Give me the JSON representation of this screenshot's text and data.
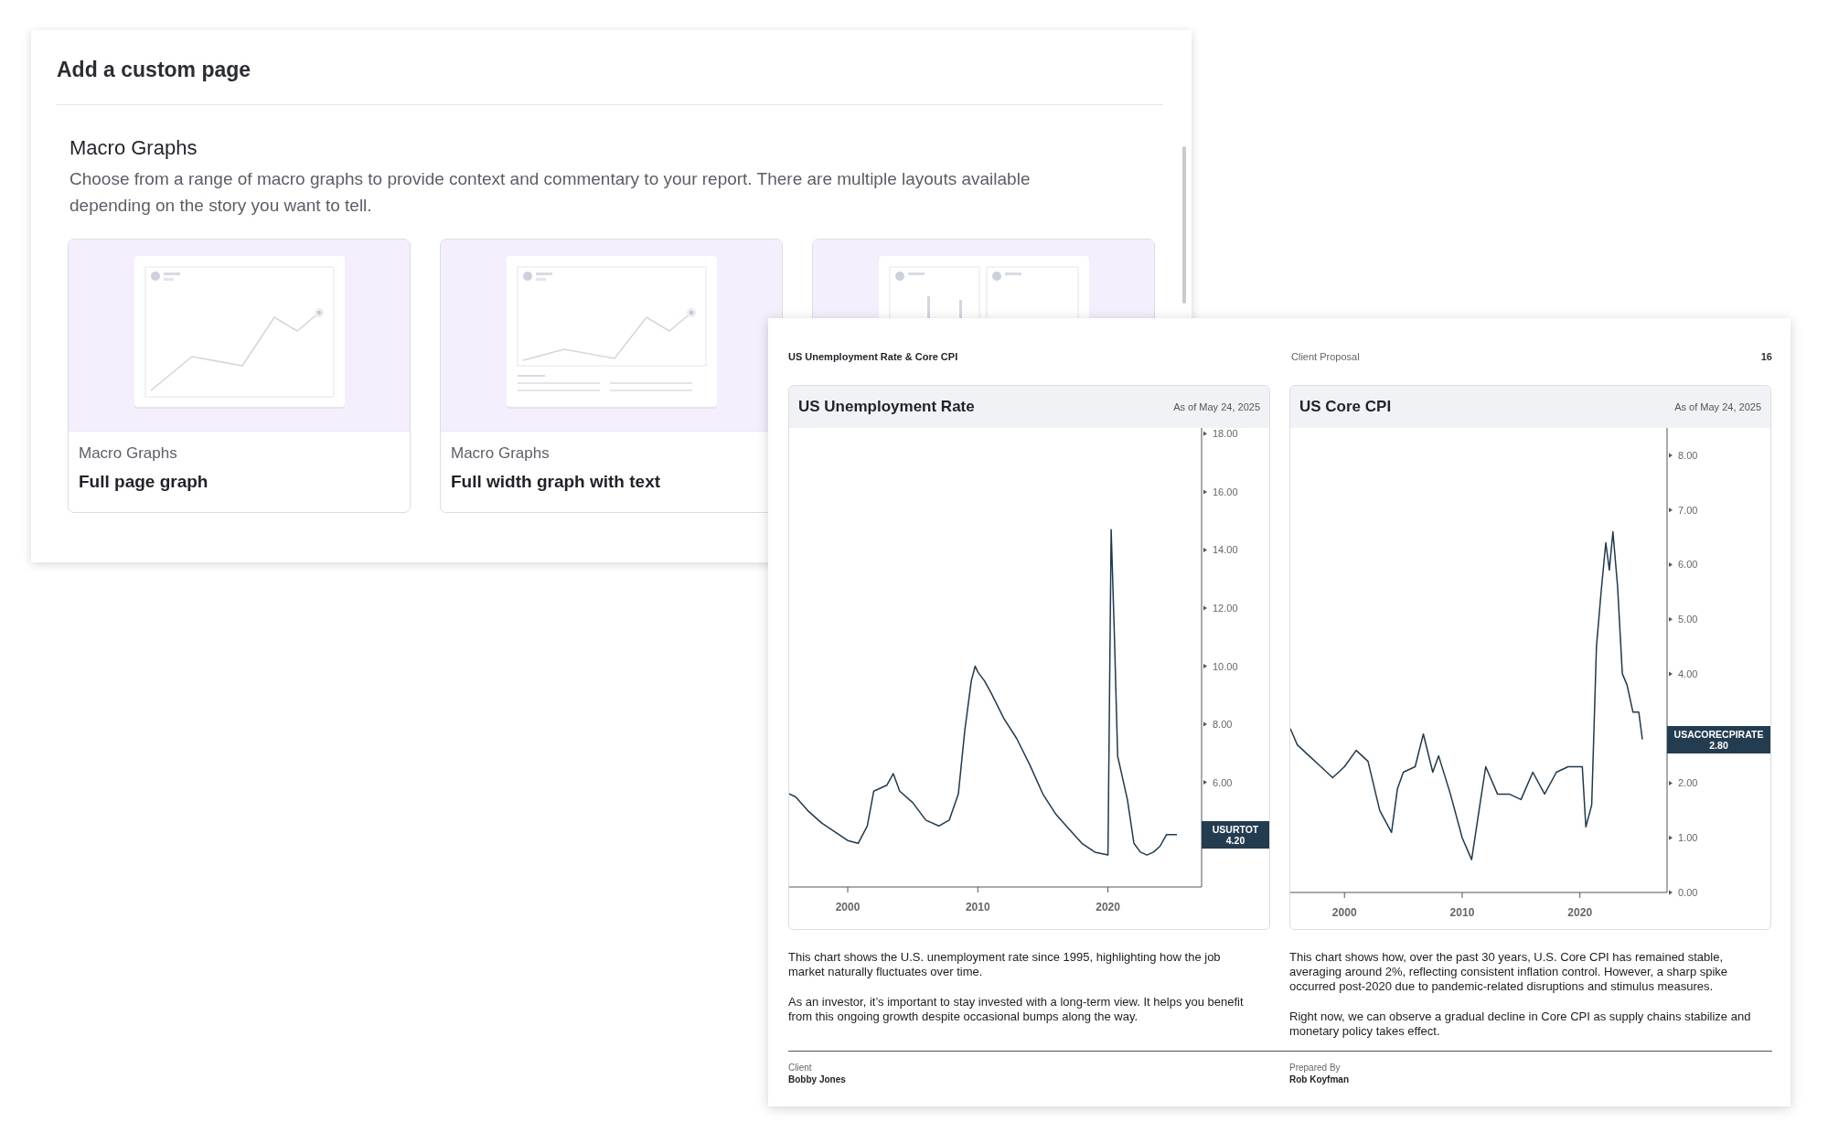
{
  "panel": {
    "title": "Add a custom page",
    "section": {
      "heading": "Macro Graphs",
      "description": "Choose from a range of macro graphs to provide context and commentary to your report. There are multiple layouts available depending on the story you want to tell."
    },
    "cards": [
      {
        "kind": "full_page",
        "category": "Macro Graphs",
        "title": "Full page graph"
      },
      {
        "kind": "full_width_text",
        "category": "Macro Graphs",
        "title": "Full width graph with text"
      },
      {
        "kind": "two_column"
      }
    ]
  },
  "report": {
    "title": "US Unemployment Rate & Core CPI",
    "document": "Client Proposal",
    "page_number": "16",
    "charts": [
      {
        "title": "US Unemployment Rate",
        "as_of": "As of May 24, 2025",
        "badge": {
          "value": "4.20"
        },
        "chart_data": {
          "type": "line",
          "x": [
            1995.5,
            1996,
            1997,
            1998,
            1999,
            2000,
            2000.8,
            2001.5,
            2002,
            2003,
            2003.5,
            2004,
            2005,
            2006,
            2007,
            2007.8,
            2008.5,
            2009,
            2009.5,
            2009.8,
            2010,
            2010.5,
            2011,
            2012,
            2013,
            2014,
            2015,
            2016,
            2017,
            2018,
            2019,
            2020,
            2020.25,
            2020.5,
            2020.75,
            2021,
            2021.5,
            2022,
            2022.5,
            2023,
            2023.5,
            2024,
            2024.5,
            2025.3
          ],
          "series": [
            {
              "name": "USURTOT",
              "color": "#1f3a4f",
              "values": [
                5.6,
                5.5,
                5.0,
                4.6,
                4.3,
                4.0,
                3.9,
                4.5,
                5.7,
                5.9,
                6.3,
                5.7,
                5.3,
                4.7,
                4.5,
                4.7,
                5.6,
                7.8,
                9.5,
                10.0,
                9.8,
                9.5,
                9.1,
                8.2,
                7.5,
                6.6,
                5.6,
                4.9,
                4.4,
                3.9,
                3.6,
                3.5,
                14.7,
                11.0,
                6.9,
                6.4,
                5.4,
                3.9,
                3.6,
                3.5,
                3.6,
                3.8,
                4.2,
                4.2
              ]
            }
          ],
          "xlim": [
            1995.5,
            2027.2
          ],
          "ylim": [
            2.4,
            18.2
          ],
          "xticks": [
            2000,
            2010,
            2020
          ],
          "yticks": [
            {
              "value": 6,
              "label": "6.00"
            },
            {
              "value": 8,
              "label": "8.00"
            },
            {
              "value": 10,
              "label": "10.00"
            },
            {
              "value": 12,
              "label": "12.00"
            },
            {
              "value": 14,
              "label": "14.00"
            },
            {
              "value": 16,
              "label": "16.00"
            },
            {
              "value": 18,
              "label": "18.00"
            }
          ]
        },
        "commentary": [
          "This chart shows the U.S. unemployment rate since 1995, highlighting how the job market naturally fluctuates over time.",
          "As an investor, it’s important to stay invested with a long-term view. It helps you benefit from this ongoing growth despite occasional bumps along the way."
        ]
      },
      {
        "title": "US Core CPI",
        "as_of": "As of May 24, 2025",
        "badge": {
          "value": "2.80"
        },
        "chart_data": {
          "type": "line",
          "x": [
            1995.4,
            1996,
            1997,
            1998,
            1999,
            2000,
            2001,
            2002,
            2003,
            2004,
            2004.5,
            2005,
            2006,
            2006.7,
            2007.5,
            2008,
            2009,
            2010,
            2010.8,
            2011.5,
            2012,
            2013,
            2014,
            2015,
            2016,
            2017,
            2018,
            2019,
            2020.2,
            2020.5,
            2021,
            2021.4,
            2021.8,
            2022.2,
            2022.5,
            2022.8,
            2023.2,
            2023.6,
            2024,
            2024.5,
            2025,
            2025.3
          ],
          "series": [
            {
              "name": "USACORECPIRATE",
              "color": "#1f3a4f",
              "values": [
                3.0,
                2.7,
                2.5,
                2.3,
                2.1,
                2.3,
                2.6,
                2.4,
                1.5,
                1.1,
                1.9,
                2.2,
                2.3,
                2.9,
                2.2,
                2.5,
                1.8,
                1.0,
                0.6,
                1.6,
                2.3,
                1.8,
                1.8,
                1.7,
                2.2,
                1.8,
                2.2,
                2.3,
                2.3,
                1.2,
                1.6,
                4.5,
                5.5,
                6.4,
                5.9,
                6.6,
                5.6,
                4.0,
                3.8,
                3.3,
                3.3,
                2.8
              ]
            }
          ],
          "xlim": [
            1995.4,
            2027.4
          ],
          "ylim": [
            0,
            8.5
          ],
          "xticks": [
            2000,
            2010,
            2020
          ],
          "yticks": [
            {
              "value": 0,
              "label": "0.00"
            },
            {
              "value": 1,
              "label": "1.00"
            },
            {
              "value": 2,
              "label": "2.00"
            },
            {
              "value": 4,
              "label": "4.00"
            },
            {
              "value": 5,
              "label": "5.00"
            },
            {
              "value": 6,
              "label": "6.00"
            },
            {
              "value": 7,
              "label": "7.00"
            },
            {
              "value": 8,
              "label": "8.00"
            }
          ]
        },
        "commentary": [
          "This chart shows how, over the past 30 years, U.S. Core CPI has remained stable, averaging around 2%, reflecting consistent inflation control. However, a sharp spike occurred post-2020 due to pandemic-related disruptions and stimulus measures.",
          "Right now, we can observe a gradual decline in Core CPI as supply chains stabilize and monetary policy takes effect."
        ]
      }
    ],
    "footer": [
      {
        "label": "Client",
        "value": "Bobby Jones"
      },
      {
        "label": "Prepared By",
        "value": "Rob Koyfman"
      }
    ]
  }
}
